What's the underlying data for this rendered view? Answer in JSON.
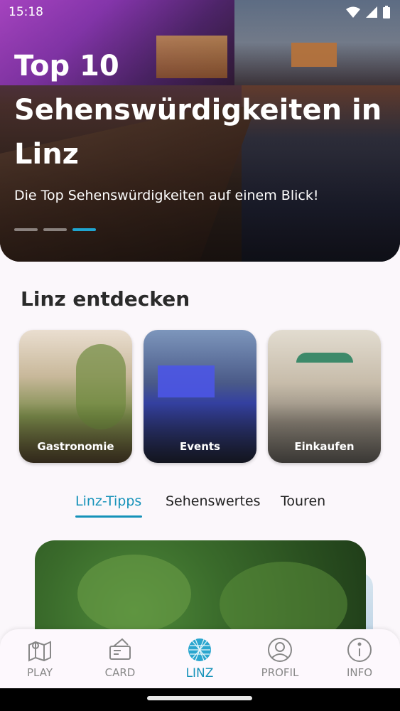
{
  "status": {
    "time": "15:18"
  },
  "hero": {
    "title": "Top 10 Sehenswürdigkeiten in Linz",
    "subtitle": "Die Top Sehenswürdigkeiten auf einem Blick!",
    "pages": 3,
    "active_page": 3
  },
  "discover": {
    "title": "Linz entdecken",
    "cards": [
      {
        "label": "Gastronomie"
      },
      {
        "label": "Events"
      },
      {
        "label": "Einkaufen"
      }
    ]
  },
  "tabs": {
    "items": [
      {
        "label": "Linz-Tipps"
      },
      {
        "label": "Sehenswertes"
      },
      {
        "label": "Touren"
      }
    ],
    "active": "Linz-Tipps"
  },
  "nav": {
    "items": [
      {
        "label": "PLAY",
        "icon": "map-icon"
      },
      {
        "label": "CARD",
        "icon": "ticket-icon"
      },
      {
        "label": "LINZ",
        "icon": "linz-globe-icon"
      },
      {
        "label": "PROFIL",
        "icon": "user-icon"
      },
      {
        "label": "INFO",
        "icon": "info-icon"
      }
    ],
    "active": "LINZ"
  },
  "colors": {
    "accent": "#1592b9",
    "inactive": "#888888",
    "background": "#fbf7fb"
  }
}
